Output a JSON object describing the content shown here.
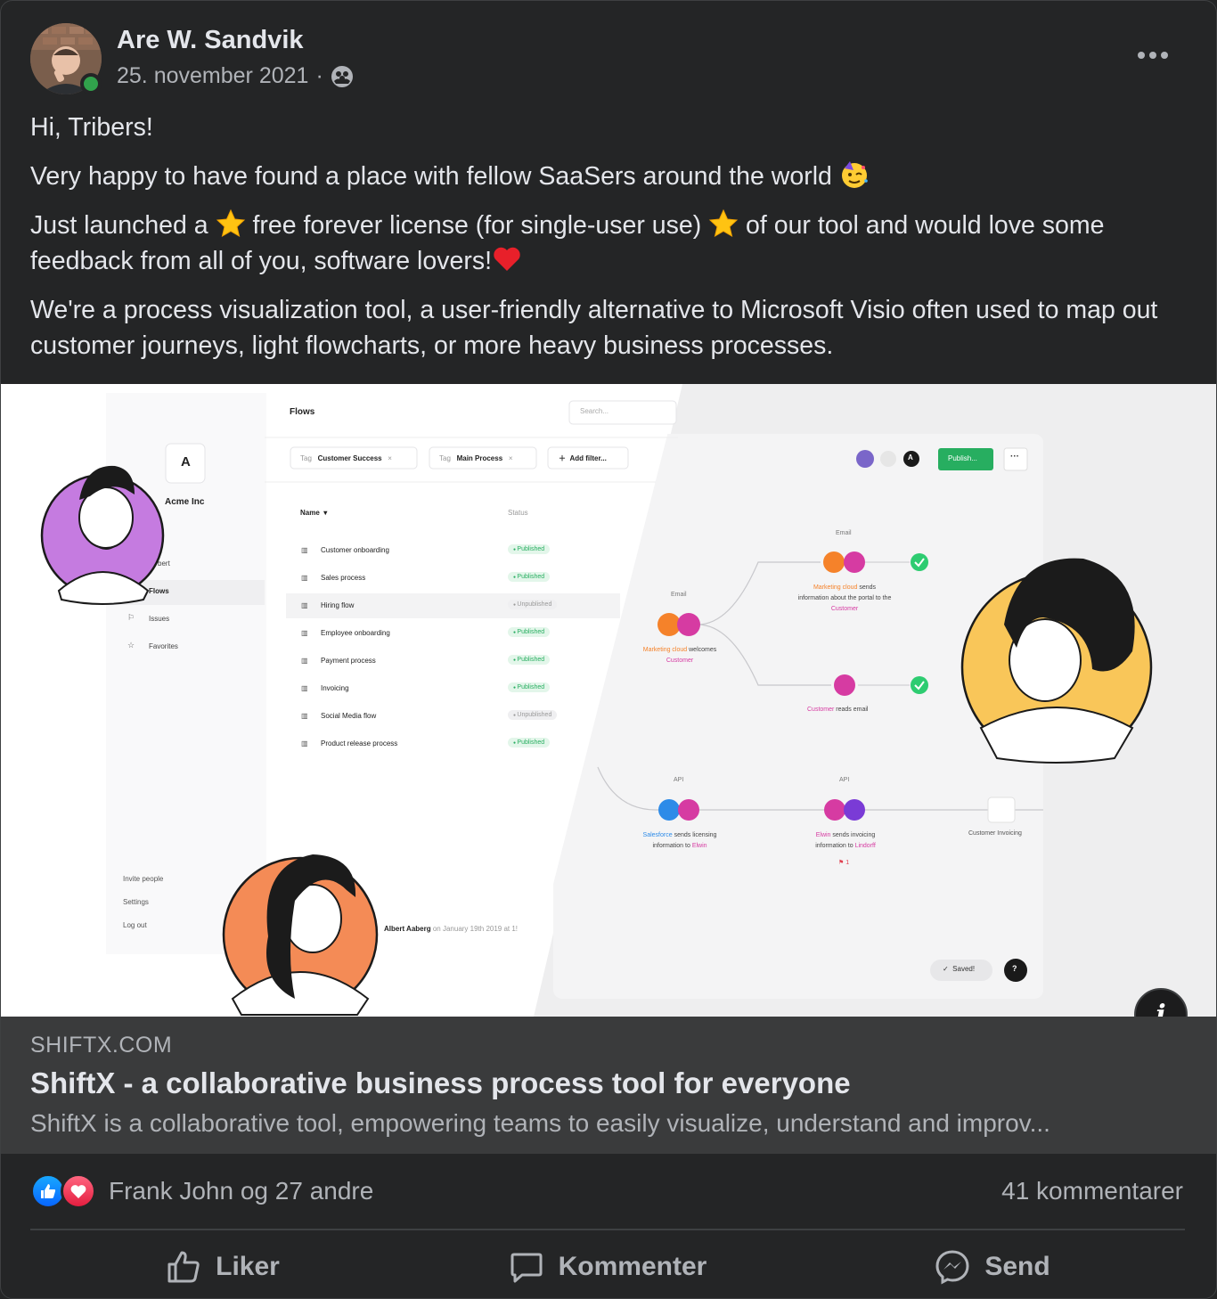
{
  "post": {
    "author": "Are W. Sandvik",
    "date": "25. november 2021",
    "separator": "·",
    "privacy_icon": "group-icon",
    "more_icon": "more-options-icon",
    "paragraphs": {
      "p1": "Hi, Tribers!",
      "p2": "Very happy to have found a place with fellow SaaSers around the world",
      "p3a": "Just launched a",
      "p3b": "free forever license (for single-user use)",
      "p3c": "of our tool and would love some feedback from all of you, software lovers!",
      "p4": "We're a process visualization tool, a user-friendly alternative to Microsoft Visio often used to map out customer journeys, light flowcharts, or more heavy business processes."
    }
  },
  "preview": {
    "app": {
      "workspace_initial": "A",
      "workspace_name": "Acme Inc",
      "user_fragment": "bert",
      "nav": [
        "Flows",
        "Issues",
        "Favorites"
      ],
      "footer_nav": [
        "Invite people",
        "Settings",
        "Log out"
      ],
      "page_title": "Flows",
      "search_placeholder": "Search...",
      "filters": [
        {
          "tag": "Tag",
          "value": "Customer Success"
        },
        {
          "tag": "Tag",
          "value": "Main Process"
        }
      ],
      "add_filter": "Add filter...",
      "col_name": "Name",
      "col_status": "Status",
      "rows": [
        {
          "name": "Customer onboarding",
          "status": "Published"
        },
        {
          "name": "Sales process",
          "status": "Published"
        },
        {
          "name": "Hiring flow",
          "status": "Unpublished"
        },
        {
          "name": "Employee onboarding",
          "status": "Published"
        },
        {
          "name": "Payment process",
          "status": "Published"
        },
        {
          "name": "Invoicing",
          "status": "Published"
        },
        {
          "name": "Social Media flow",
          "status": "Unpublished"
        },
        {
          "name": "Product release process",
          "status": "Published"
        }
      ],
      "footer_author": "Albert Aaberg",
      "footer_date": "on January 19th 2019 at 1!"
    },
    "canvas": {
      "publish": "Publish...",
      "avatar_initial": "A",
      "saved": "Saved!",
      "help": "?",
      "nodes": {
        "email1_label": "Email",
        "email1_caption_a": "Marketing cloud",
        "email1_caption_b": "welcomes",
        "email1_caption_c": "Customer",
        "email2_label": "Email",
        "email2_caption_a": "Marketing cloud",
        "email2_caption_b": "sends",
        "email2_caption_c": "information about the portal to the",
        "email2_caption_d": "Customer",
        "reads_caption_a": "Customer",
        "reads_caption_b": "reads email",
        "api1_label": "API",
        "api1_caption_a": "Salesforce",
        "api1_caption_b": "sends licensing",
        "api1_caption_c": "information to",
        "api1_caption_d": "Elwin",
        "api2_label": "API",
        "api2_caption_a": "Elwin",
        "api2_caption_b": "sends invoicing",
        "api2_caption_c": "information to",
        "api2_caption_d": "Lindorff",
        "api2_flag": "1",
        "invoicing_caption": "Customer Invoicing"
      }
    }
  },
  "link": {
    "domain": "SHIFTX.COM",
    "title": "ShiftX - a collaborative business process tool for everyone",
    "description": "ShiftX is a collaborative tool, empowering teams to easily visualize, understand and improv..."
  },
  "stats": {
    "reactors": "Frank John og 27 andre",
    "comments": "41 kommentarer"
  },
  "actions": {
    "like": "Liker",
    "comment": "Kommenter",
    "send": "Send"
  },
  "colors": {
    "background": "#242526",
    "card": "#3a3b3c",
    "text": "#e4e6eb",
    "muted": "#b0b3b8",
    "online": "#31a24c",
    "publish_green": "#27ae60",
    "magenta": "#d63ba2",
    "orange": "#f5822a",
    "blue": "#2d8be8"
  }
}
